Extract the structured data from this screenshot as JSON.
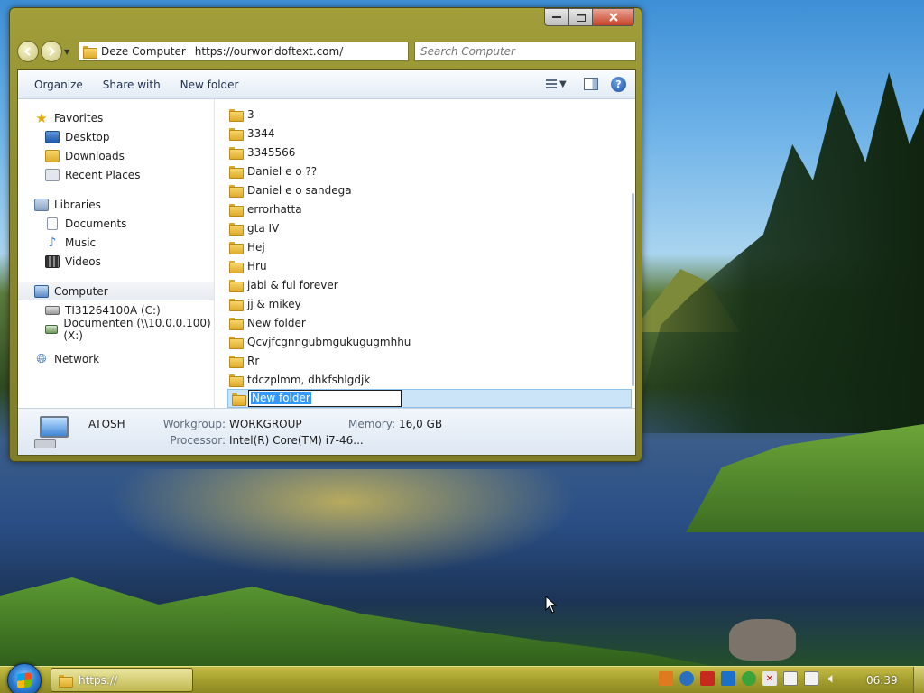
{
  "window": {
    "address_location": "Deze Computer",
    "address_url": "https://ourworldoftext.com/",
    "search_placeholder": "Search Computer"
  },
  "toolbar": {
    "organize": "Organize",
    "share_with": "Share with",
    "new_folder": "New folder"
  },
  "navigation": {
    "favorites": {
      "label": "Favorites",
      "items": [
        "Desktop",
        "Downloads",
        "Recent Places"
      ]
    },
    "libraries": {
      "label": "Libraries",
      "items": [
        "Documents",
        "Music",
        "Videos"
      ]
    },
    "computer": {
      "label": "Computer",
      "items": [
        "TI31264100A (C:)",
        "Documenten (\\\\10.0.0.100) (X:)"
      ]
    },
    "network": {
      "label": "Network"
    }
  },
  "files": [
    "3",
    "3344",
    "3345566",
    "Daniel e o ??",
    "Daniel e o sandega",
    "errorhatta",
    "gta IV",
    "Hej",
    "Hru",
    "jabi & ful forever",
    "jj & mikey",
    "New folder",
    "Qcvjfcgnngubmgukugugmhhu",
    "Rr",
    "tdczplmm, dhkfshlgdjk"
  ],
  "rename": {
    "value": "New folder"
  },
  "details": {
    "computer_name": "ATOSH",
    "workgroup_label": "Workgroup:",
    "workgroup_value": "WORKGROUP",
    "memory_label": "Memory:",
    "memory_value": "16,0 GB",
    "processor_label": "Processor:",
    "processor_value": "Intel(R) Core(TM) i7-46..."
  },
  "taskbar": {
    "window_button": "https://",
    "clock": "06:39"
  },
  "colors": {
    "window_frame": "#8c8a2e",
    "taskbar": "#a59f2e",
    "selection": "#cce4f7",
    "text_selection": "#3399ff"
  }
}
